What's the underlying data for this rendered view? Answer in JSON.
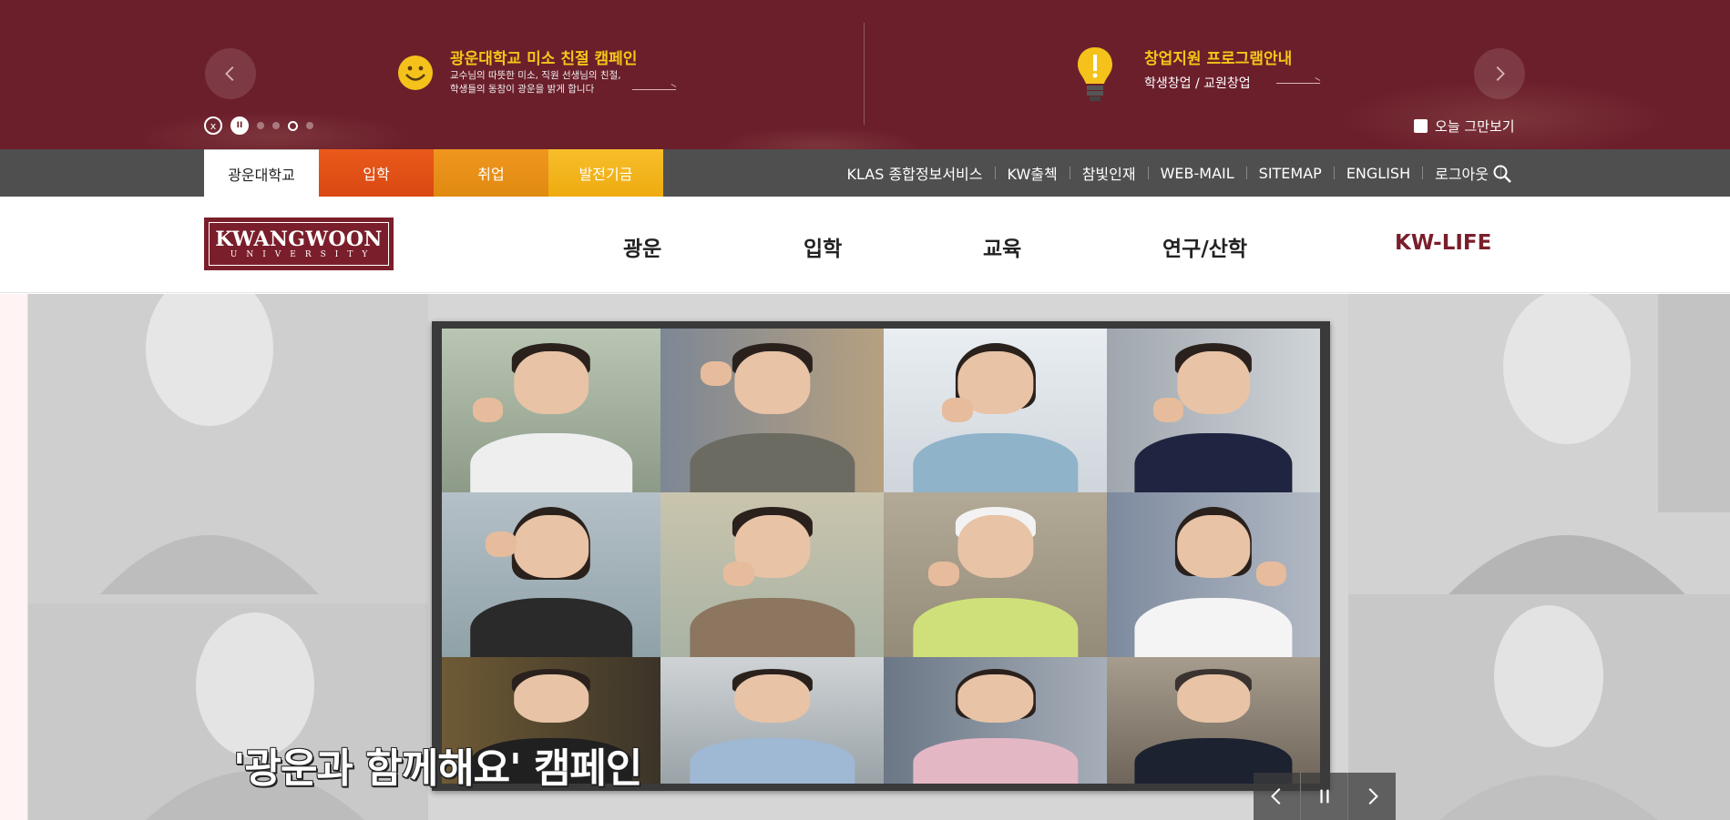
{
  "promo": {
    "item1": {
      "title": "광운대학교 미소 친절 캠페인",
      "desc_line1": "교수님의 따뜻한 미소, 직원 선생님의 친절,",
      "desc_line2": "학생들의 동참이 광운을 밝게 합니다",
      "icon": "smiley-icon"
    },
    "item2": {
      "title": "창업지원 프로그램안내",
      "subtitle": "학생창업 / 교원창업",
      "icon": "lightbulb-icon"
    },
    "close_icon": "x",
    "pause_icon": "II",
    "dots_total": 4,
    "active_dot": 3,
    "today_close_label": "오늘 그만보기"
  },
  "utility": {
    "tabs": [
      "광운대학교",
      "입학",
      "취업",
      "발전기금"
    ],
    "links": [
      "KLAS 종합정보서비스",
      "KW출첵",
      "참빛인재",
      "WEB-MAIL",
      "SITEMAP",
      "ENGLISH",
      "로그아웃"
    ]
  },
  "header": {
    "logo_line1": "KWANGWOON",
    "logo_line2": "UNIVERSITY",
    "gnb": [
      "광운",
      "입학",
      "교육",
      "연구/산학",
      "KW-LIFE"
    ]
  },
  "hero": {
    "caption": "'광운과 함께해요' 캠페인",
    "controls_pause": "II"
  },
  "colors": {
    "brand_maroon": "#7b1e2b",
    "promo_bg": "#6b1f2b",
    "utility_bg": "#4f4f4f",
    "admission_orange": "#e65214",
    "career_orange": "#eb8f16",
    "fund_yellow": "#f3b51d",
    "promo_title_yellow": "#f5c518"
  }
}
